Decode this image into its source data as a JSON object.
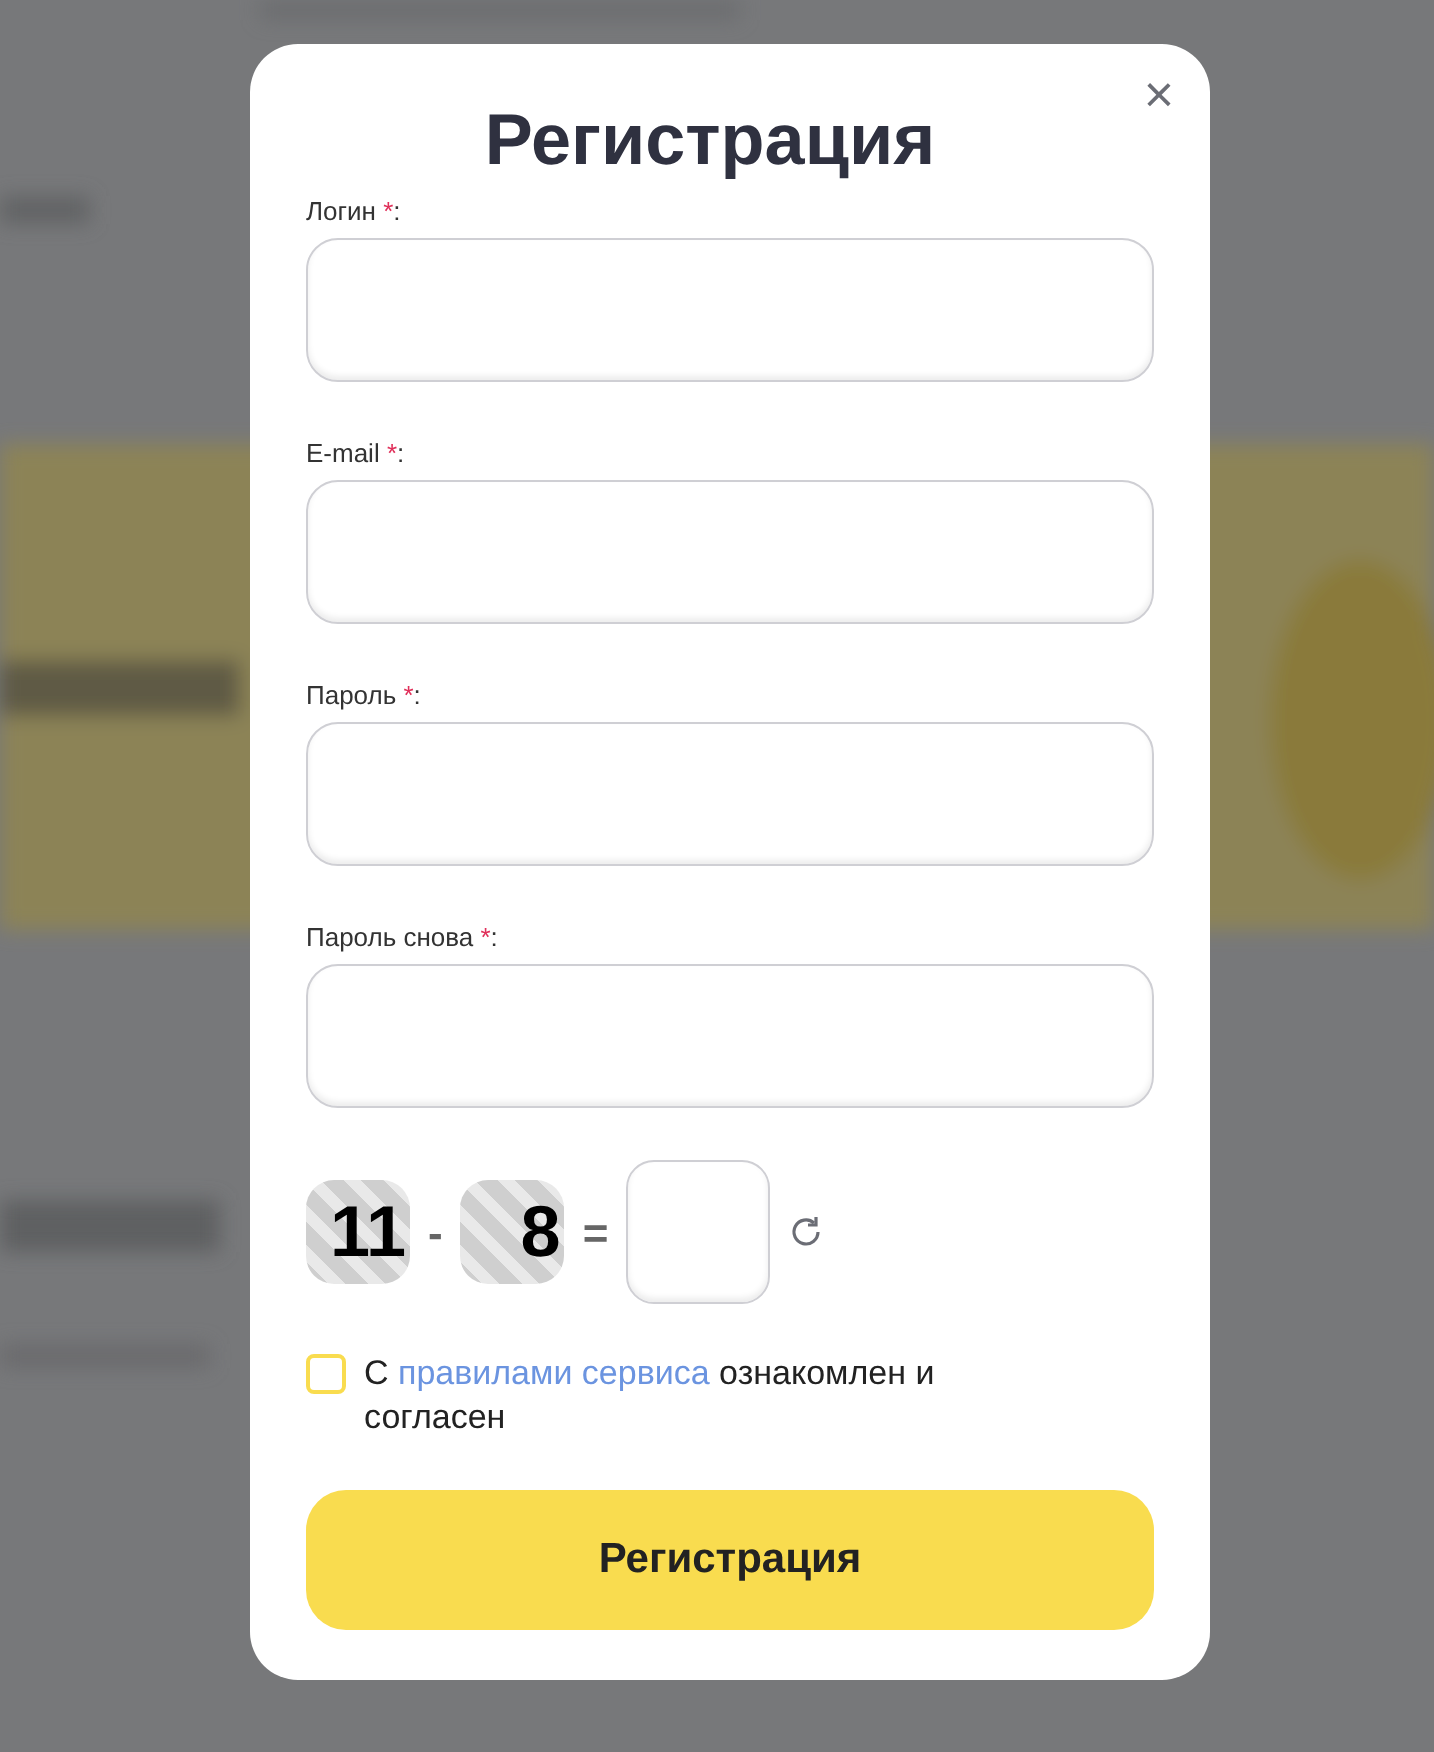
{
  "modal": {
    "title": "Регистрация",
    "close": "×",
    "fields": [
      {
        "label": "Логин",
        "required_mark": "*",
        "suffix": ":"
      },
      {
        "label": "E-mail",
        "required_mark": "*",
        "suffix": ":"
      },
      {
        "label": "Пароль",
        "required_mark": "*",
        "suffix": ":"
      },
      {
        "label": "Пароль снова",
        "required_mark": "*",
        "suffix": ":"
      }
    ],
    "captcha": {
      "first": "11",
      "operator": "-",
      "second": "8",
      "equals": "="
    },
    "agreement": {
      "checked": false,
      "before": "С",
      "link": "правилами сервиса",
      "after": "ознакомлен и согласен"
    },
    "submit": "Регистрация"
  }
}
